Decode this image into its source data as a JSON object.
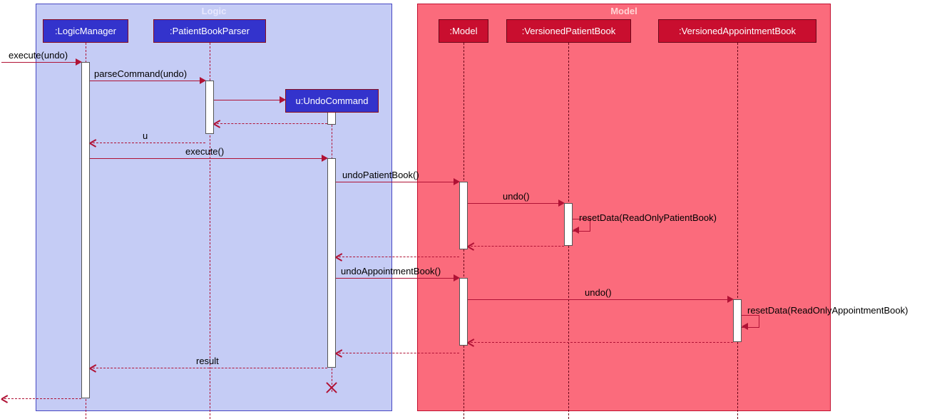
{
  "boxes": {
    "logic": {
      "title": "Logic"
    },
    "model": {
      "title": "Model"
    }
  },
  "participants": {
    "logicManager": ":LogicManager",
    "patientBookParser": ":PatientBookParser",
    "undoCommand": "u:UndoCommand",
    "model": ":Model",
    "versionedPatientBook": ":VersionedPatientBook",
    "versionedAppointmentBook": ":VersionedAppointmentBook"
  },
  "messages": {
    "executeUndo": "execute(undo)",
    "parseCommand": "parseCommand(undo)",
    "u": "u",
    "execute": "execute()",
    "undoPatientBook": "undoPatientBook()",
    "undo1": "undo()",
    "resetDataPatient": "resetData(ReadOnlyPatientBook)",
    "undoAppointmentBook": "undoAppointmentBook()",
    "undo2": "undo()",
    "resetDataAppointment": "resetData(ReadOnlyAppointmentBook)",
    "result": "result"
  },
  "chart_data": {
    "type": "sequence-diagram",
    "boxes": [
      {
        "name": "Logic",
        "participants": [
          "LogicManager",
          "PatientBookParser",
          "UndoCommand"
        ]
      },
      {
        "name": "Model",
        "participants": [
          "Model",
          "VersionedPatientBook",
          "VersionedAppointmentBook"
        ]
      }
    ],
    "participants": [
      {
        "id": "LogicManager",
        "label": ":LogicManager"
      },
      {
        "id": "PatientBookParser",
        "label": ":PatientBookParser"
      },
      {
        "id": "UndoCommand",
        "label": "u:UndoCommand",
        "created": true,
        "destroyed": true
      },
      {
        "id": "Model",
        "label": ":Model"
      },
      {
        "id": "VersionedPatientBook",
        "label": ":VersionedPatientBook"
      },
      {
        "id": "VersionedAppointmentBook",
        "label": ":VersionedAppointmentBook"
      }
    ],
    "messages": [
      {
        "from": "external",
        "to": "LogicManager",
        "label": "execute(undo)",
        "type": "sync"
      },
      {
        "from": "LogicManager",
        "to": "PatientBookParser",
        "label": "parseCommand(undo)",
        "type": "sync"
      },
      {
        "from": "PatientBookParser",
        "to": "UndoCommand",
        "label": "",
        "type": "create"
      },
      {
        "from": "UndoCommand",
        "to": "PatientBookParser",
        "label": "",
        "type": "return"
      },
      {
        "from": "PatientBookParser",
        "to": "LogicManager",
        "label": "u",
        "type": "return"
      },
      {
        "from": "LogicManager",
        "to": "UndoCommand",
        "label": "execute()",
        "type": "sync"
      },
      {
        "from": "UndoCommand",
        "to": "Model",
        "label": "undoPatientBook()",
        "type": "sync"
      },
      {
        "from": "Model",
        "to": "VersionedPatientBook",
        "label": "undo()",
        "type": "sync"
      },
      {
        "from": "VersionedPatientBook",
        "to": "VersionedPatientBook",
        "label": "resetData(ReadOnlyPatientBook)",
        "type": "self"
      },
      {
        "from": "VersionedPatientBook",
        "to": "Model",
        "label": "",
        "type": "return"
      },
      {
        "from": "Model",
        "to": "UndoCommand",
        "label": "",
        "type": "return"
      },
      {
        "from": "UndoCommand",
        "to": "Model",
        "label": "undoAppointmentBook()",
        "type": "sync"
      },
      {
        "from": "Model",
        "to": "VersionedAppointmentBook",
        "label": "undo()",
        "type": "sync"
      },
      {
        "from": "VersionedAppointmentBook",
        "to": "VersionedAppointmentBook",
        "label": "resetData(ReadOnlyAppointmentBook)",
        "type": "self"
      },
      {
        "from": "VersionedAppointmentBook",
        "to": "Model",
        "label": "",
        "type": "return"
      },
      {
        "from": "Model",
        "to": "UndoCommand",
        "label": "",
        "type": "return"
      },
      {
        "from": "UndoCommand",
        "to": "LogicManager",
        "label": "result",
        "type": "return"
      },
      {
        "from": "LogicManager",
        "to": "external",
        "label": "",
        "type": "return"
      },
      {
        "from": "UndoCommand",
        "to": "UndoCommand",
        "label": "",
        "type": "destroy"
      }
    ]
  }
}
